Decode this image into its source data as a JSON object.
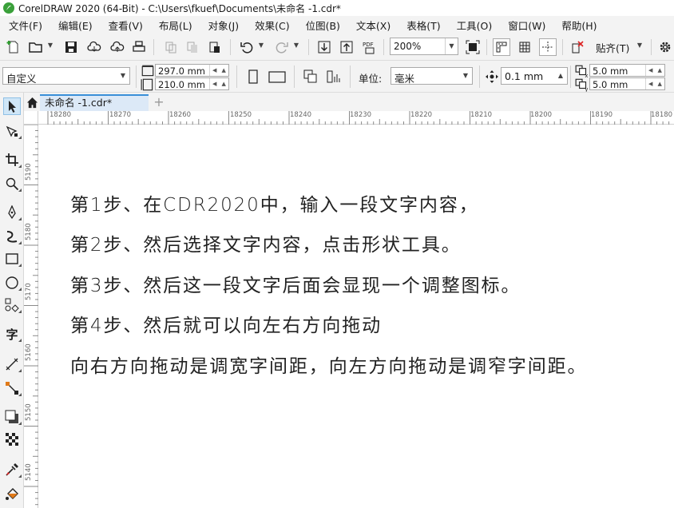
{
  "window": {
    "title": "CorelDRAW 2020 (64-Bit) - C:\\Users\\fkuef\\Documents\\未命名 -1.cdr*"
  },
  "menu": {
    "items": [
      {
        "label": "文件(F)"
      },
      {
        "label": "编辑(E)"
      },
      {
        "label": "查看(V)"
      },
      {
        "label": "布局(L)"
      },
      {
        "label": "对象(J)"
      },
      {
        "label": "效果(C)"
      },
      {
        "label": "位图(B)"
      },
      {
        "label": "文本(X)"
      },
      {
        "label": "表格(T)"
      },
      {
        "label": "工具(O)"
      },
      {
        "label": "窗口(W)"
      },
      {
        "label": "帮助(H)"
      }
    ]
  },
  "toolbar": {
    "zoom_value": "200%",
    "snap_label": "贴齐(T)",
    "pdf_label": "PDF"
  },
  "property_bar": {
    "page_preset": "自定义",
    "width": "297.0 mm",
    "height": "210.0 mm",
    "unit_label": "单位:",
    "unit_value": "毫米",
    "nudge": "0.1 mm",
    "dup_x": "5.0 mm",
    "dup_y": "5.0 mm"
  },
  "tabs": {
    "document": "未命名 -1.cdr*"
  },
  "rulers": {
    "horizontal": [
      "18280",
      "18270",
      "18260",
      "18250",
      "18240",
      "18230",
      "18220",
      "18210",
      "18200",
      "18190",
      "18180"
    ],
    "vertical": [
      "5190",
      "5180",
      "5170",
      "5160",
      "5150",
      "5140"
    ]
  },
  "canvas": {
    "lines": [
      "第1步、在CDR2020中，输入一段文字内容，",
      "第2步、然后选择文字内容，点击形状工具。",
      "第3步、然后这一段文字后面会显现一个调整图标。",
      "第4步、然后就可以向左右方向拖动",
      "向右方向拖动是调宽字间距，向左方向拖动是调窄字间距。"
    ]
  },
  "toolbox": {
    "text_tool_label": "字"
  }
}
